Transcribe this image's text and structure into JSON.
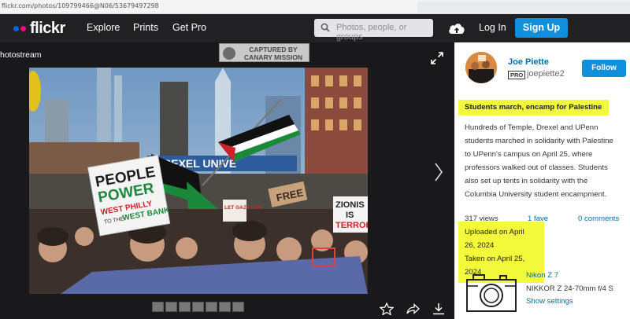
{
  "browser": {
    "url": "flickr.com/photos/109799466@N06/53679497298"
  },
  "header": {
    "logo_text": "flickr",
    "nav": [
      "Explore",
      "Prints",
      "Get Pro"
    ],
    "search_placeholder": "Photos, people, or groups",
    "login_label": "Log In",
    "signup_label": "Sign Up"
  },
  "photo_area": {
    "breadcrumb": "hotostream",
    "watermark_line1": "CAPTURED BY",
    "watermark_line2": "CANARY MISSION"
  },
  "photo_signs": {
    "people_power_1": "PEOPLE",
    "people_power_2": "POWER",
    "west_philly": "WEST PHILLY",
    "to_the": "TO THE",
    "west_bank": "WEST BANK",
    "free": "FREE",
    "let_gaza_live": "LET GAZA LIVE",
    "zionism_1": "ZIONIS",
    "zionism_2": "IS",
    "zionism_3": "TERROR",
    "banner_text": "DREXEL UNIVE"
  },
  "sidebar": {
    "username": "Joe Piette",
    "pro_badge": "PRO",
    "handle": "joepiette2",
    "follow_label": "Follow",
    "photo_title": "Students march, encamp for Palestine",
    "description": "Hundreds of Temple, Drexel and UPenn students marched in solidarity with Palestine to UPenn's campus on April 25, where professors walked out of classes. Students also set up tents in solidarity with the Columbia University student encampment.",
    "views": "317 views",
    "faves": "1 fave",
    "comments": "0 comments",
    "uploaded": "Uploaded on April 26, 2024",
    "taken": "Taken on April 25, 2024",
    "camera_model": "Nikon Z 7",
    "lens": "NIKKOR Z 24-70mm f/4 S",
    "show_settings": "Show settings"
  },
  "colors": {
    "accent_blue": "#128fdc",
    "link_blue": "#006dac",
    "highlight": "#f3fa3b",
    "header_bg": "#212124"
  }
}
